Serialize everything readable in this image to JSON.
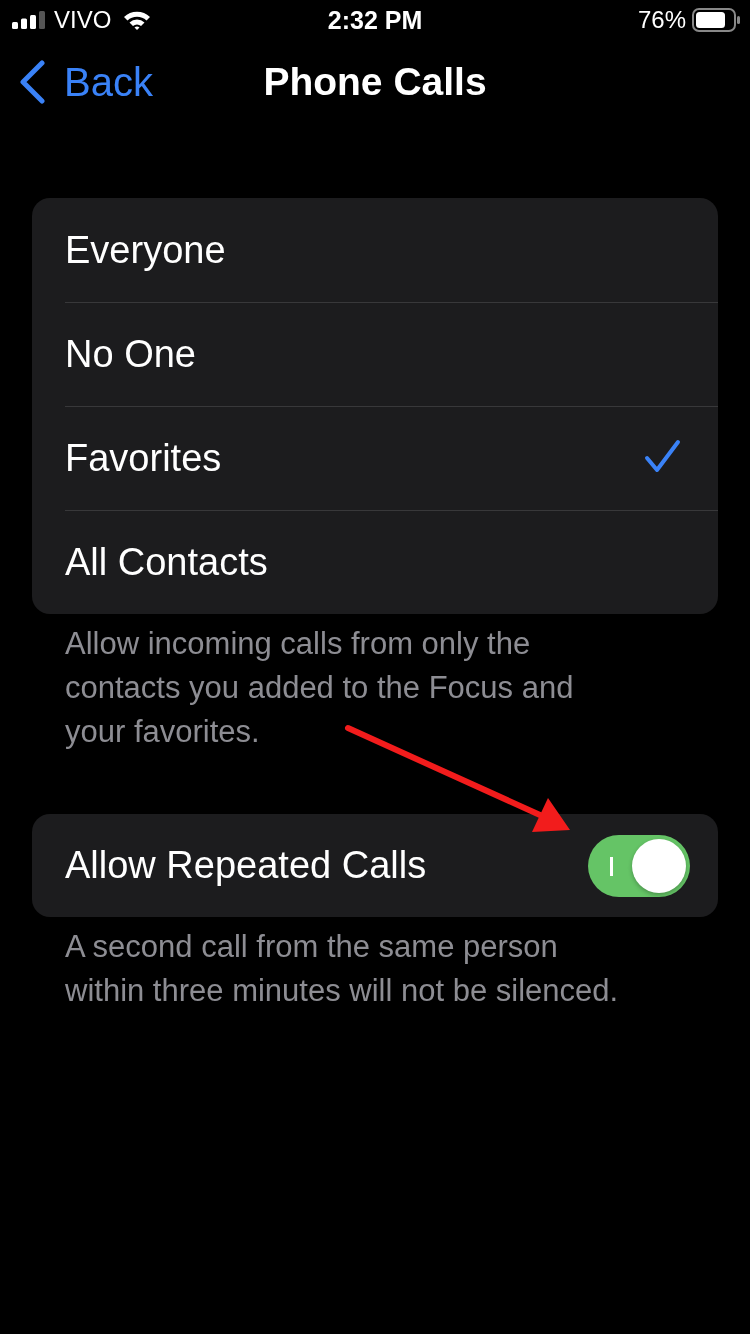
{
  "status_bar": {
    "carrier": "VIVO",
    "time": "2:32 PM",
    "battery": "76%"
  },
  "nav": {
    "back": "Back",
    "title": "Phone Calls"
  },
  "options": [
    {
      "label": "Everyone",
      "selected": false
    },
    {
      "label": "No One",
      "selected": false
    },
    {
      "label": "Favorites",
      "selected": true
    },
    {
      "label": "All Contacts",
      "selected": false
    }
  ],
  "options_footer": "Allow incoming calls from only the contacts you added to the Focus and your favorites.",
  "repeated_calls": {
    "label": "Allow Repeated Calls",
    "on": true
  },
  "repeated_footer": "A second call from the same person within three minutes will not be silenced."
}
